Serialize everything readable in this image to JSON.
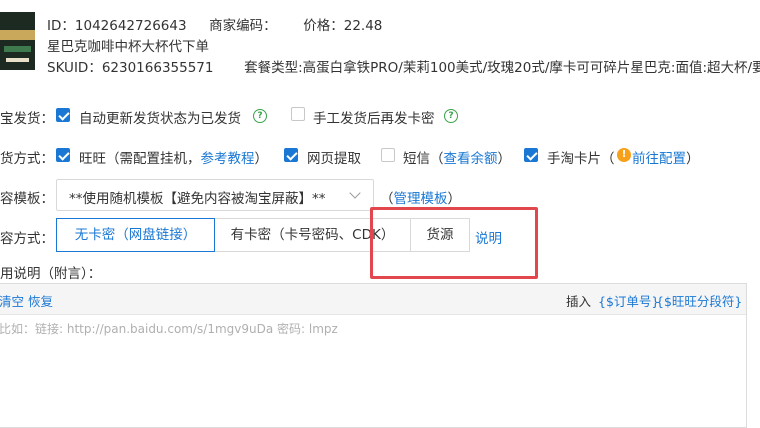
{
  "product": {
    "id_label": "ID：",
    "id_value": "1042642726643",
    "merchant_code_label": "商家编码：",
    "price_label": "价格：",
    "price_value": "22.48",
    "name": "星巴克咖啡中杯大杯代下单",
    "skuid_label": "SKUID：",
    "skuid_value": "6230166355571",
    "package_label": "套餐类型:",
    "package_value": "高蛋白拿铁PRO/茉莉100美式/玫瑰20式/摩卡可可碎片星巴克:面值:超大杯/要用"
  },
  "auto_ship": {
    "label": "宝发货：",
    "option1": "自动更新发货状态为已发货",
    "option1_checked": true,
    "option2": "手工发货后再发卡密",
    "option2_checked": false
  },
  "ship_method": {
    "label": "货方式：",
    "wangwang": "旺旺（需配置挂机，",
    "wangwang_link": "参考教程",
    "wangwang_close": "）",
    "web": "网页提取",
    "sms": "短信（",
    "sms_link": "查看余额",
    "sms_close": "）",
    "taobao": "手淘卡片（",
    "taobao_link": "前往配置",
    "taobao_close": "）"
  },
  "template": {
    "label": "容模板：",
    "selected": "**使用随机模板【避免内容被淘宝屏蔽】**",
    "manage_open": "（",
    "manage_link": "管理模板",
    "manage_close": "）"
  },
  "content_method": {
    "label": "容方式：",
    "tabs": [
      "无卡密（网盘链接）",
      "有卡密（卡号密码、CDK）",
      "货源"
    ],
    "active_index": 0,
    "explain_link": "说明"
  },
  "usage": {
    "label": "用说明（附言）：",
    "clear": "清空",
    "restore": "恢复",
    "insert_label": "插入",
    "insert_order": "{$订单号}",
    "insert_wangwang": "{$旺旺分段符}",
    "placeholder": "比如：链接: http://pan.baidu.com/s/1mgv9uDa 密码: lmpz"
  },
  "colors": {
    "accent": "#1a78d4",
    "highlight": "#e2474d",
    "help_green": "#3aa34a",
    "warning": "#f7a01a"
  }
}
